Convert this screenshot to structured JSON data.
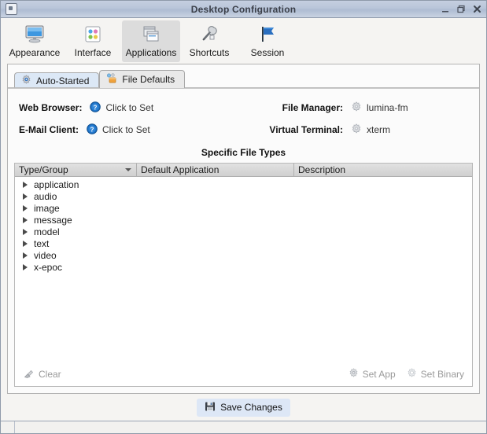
{
  "window": {
    "title": "Desktop Configuration",
    "icon": "window-icon",
    "buttons": {
      "minimize": "minimize-button",
      "restore": "restore-button",
      "close": "close-button"
    }
  },
  "toolbar": {
    "items": [
      {
        "label": "Appearance",
        "icon": "monitor-icon",
        "selected": false
      },
      {
        "label": "Interface",
        "icon": "dots-grid-icon",
        "selected": false
      },
      {
        "label": "Applications",
        "icon": "windows-stack-icon",
        "selected": true
      },
      {
        "label": "Shortcuts",
        "icon": "wrench-icon",
        "selected": false
      },
      {
        "label": "Session",
        "icon": "flag-icon",
        "selected": false
      }
    ]
  },
  "tabs": [
    {
      "label": "Auto-Started",
      "icon": "gear-blue-icon",
      "active": false
    },
    {
      "label": "File Defaults",
      "icon": "file-types-icon",
      "active": true
    }
  ],
  "defaults": {
    "web_browser": {
      "label": "Web Browser:",
      "value": "Click to Set",
      "icon": "help-question-icon"
    },
    "email_client": {
      "label": "E-Mail Client:",
      "value": "Click to Set",
      "icon": "help-question-icon"
    },
    "file_manager": {
      "label": "File Manager:",
      "value": "lumina-fm",
      "icon": "gear-gray-icon"
    },
    "virtual_terminal": {
      "label": "Virtual Terminal:",
      "value": "xterm",
      "icon": "gear-gray-icon"
    }
  },
  "file_types": {
    "section_title": "Specific File Types",
    "columns": [
      {
        "label": "Type/Group",
        "sorted": "descending"
      },
      {
        "label": "Default Application",
        "sorted": ""
      },
      {
        "label": "Description",
        "sorted": ""
      }
    ],
    "rows": [
      {
        "type": "application",
        "default_application": "",
        "description": ""
      },
      {
        "type": "audio",
        "default_application": "",
        "description": ""
      },
      {
        "type": "image",
        "default_application": "",
        "description": ""
      },
      {
        "type": "message",
        "default_application": "",
        "description": ""
      },
      {
        "type": "model",
        "default_application": "",
        "description": ""
      },
      {
        "type": "text",
        "default_application": "",
        "description": ""
      },
      {
        "type": "video",
        "default_application": "",
        "description": ""
      },
      {
        "type": "x-epoc",
        "default_application": "",
        "description": ""
      }
    ],
    "actions": {
      "clear": {
        "label": "Clear",
        "icon": "eraser-icon",
        "enabled": false
      },
      "set_app": {
        "label": "Set App",
        "icon": "gear-icon",
        "enabled": false
      },
      "set_binary": {
        "label": "Set Binary",
        "icon": "gear-outline-icon",
        "enabled": false
      }
    }
  },
  "save": {
    "label": "Save Changes",
    "icon": "floppy-disk-icon"
  },
  "colors": {
    "titlebar": "#b9c5d9",
    "window_bg": "#f5f4f2",
    "panel_bg": "#fbfbfb",
    "tab_inactive": "#dce8f6",
    "tab_active": "#e9e9e9",
    "header_bg": "#d6d6d6",
    "accent_blue": "#1a6fc4",
    "disabled_text": "#9a9a9a",
    "save_bg": "#dde7f6"
  }
}
